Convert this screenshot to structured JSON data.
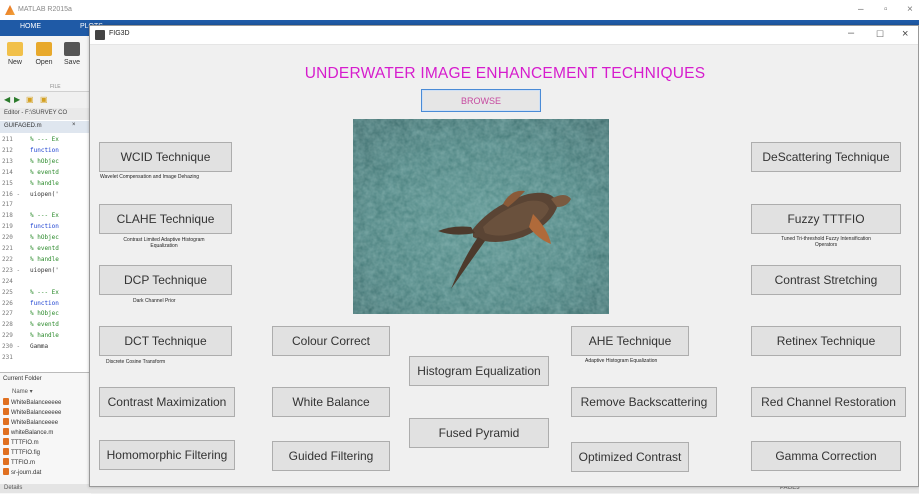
{
  "matlab": {
    "title": "MATLAB R2015a",
    "tabs": {
      "home": "HOME",
      "plots": "PLOTS"
    },
    "ribbon": {
      "new": "New",
      "open": "Open",
      "save": "Save",
      "file_group": "FILE"
    },
    "editor_title": "Editor - F:\\SURVEY CO",
    "editor_tab": "GUIFAGED.m",
    "code_lines": [
      {
        "n": "211",
        "t": "% --- Ex",
        "k": "comment"
      },
      {
        "n": "212",
        "t": "function",
        "k": "kw"
      },
      {
        "n": "213",
        "t": "% hObjec",
        "k": "comment"
      },
      {
        "n": "214",
        "t": "% eventd",
        "k": "comment"
      },
      {
        "n": "215",
        "t": "% handle",
        "k": "comment"
      },
      {
        "n": "216 -",
        "t": "uiopen('",
        "k": "fn"
      },
      {
        "n": "217",
        "t": "",
        "k": "fn"
      },
      {
        "n": "218",
        "t": "% --- Ex",
        "k": "comment"
      },
      {
        "n": "219",
        "t": "function",
        "k": "kw"
      },
      {
        "n": "220",
        "t": "% hObjec",
        "k": "comment"
      },
      {
        "n": "221",
        "t": "% eventd",
        "k": "comment"
      },
      {
        "n": "222",
        "t": "% handle",
        "k": "comment"
      },
      {
        "n": "223 -",
        "t": "uiopen('",
        "k": "fn"
      },
      {
        "n": "224",
        "t": "",
        "k": "fn"
      },
      {
        "n": "225",
        "t": "% --- Ex",
        "k": "comment"
      },
      {
        "n": "226",
        "t": "function",
        "k": "kw"
      },
      {
        "n": "227",
        "t": "% hObjec",
        "k": "comment"
      },
      {
        "n": "228",
        "t": "% eventd",
        "k": "comment"
      },
      {
        "n": "229",
        "t": "% handle",
        "k": "comment"
      },
      {
        "n": "230 -",
        "t": "Gamma",
        "k": "fn"
      },
      {
        "n": "231",
        "t": "",
        "k": "fn"
      }
    ],
    "current_folder": {
      "header": "Current Folder",
      "name_col": "Name ▾",
      "files": [
        "WhiteBalanceeeee",
        "WhiteBalanceeeee",
        "WhiteBalanceeee",
        "whiteBalance.m",
        "TTTFIO.m",
        "TTTFIO.fig",
        "TTFIO.m",
        "sr-journ.dat"
      ]
    },
    "status_left": "Details",
    "status_right": "PAGE3"
  },
  "figure": {
    "window_title": "FIG3D",
    "heading": "UNDERWATER IMAGE ENHANCEMENT TECHNIQUES",
    "browse": "BROWSE",
    "buttons": {
      "wcid": "WCID Technique",
      "clahe": "CLAHE Technique",
      "dcp": "DCP Technique",
      "dct": "DCT Technique",
      "contrast_max": "Contrast Maximization",
      "homomorphic": "Homomorphic Filtering",
      "colour_correct": "Colour Correct",
      "white_balance": "White Balance",
      "guided_filtering": "Guided Filtering",
      "histogram_eq": "Histogram Equalization",
      "fused_pyramid": "Fused Pyramid",
      "ahe": "AHE Technique",
      "remove_backscatter": "Remove Backscattering",
      "optimized_contrast": "Optimized Contrast",
      "descattering": "DeScattering Technique",
      "fuzzy_tttfio": "Fuzzy TTTFIO",
      "contrast_stretching": "Contrast Stretching",
      "retinex": "Retinex Technique",
      "red_channel": "Red Channel Restoration",
      "gamma": "Gamma Correction"
    },
    "captions": {
      "wcid": "Wavelet Compensation and Image Dehazing",
      "clahe_1": "Contrast Limited Adaptive Histogram",
      "clahe_2": "Equalization",
      "dcp": "Dark Channel Prior",
      "dct": "Discrete Cosine Transform",
      "ahe": "Adaptive Histogram Equalization",
      "fuzzy_1": "Tuned Tri-threshold Fuzzy Intensification",
      "fuzzy_2": "Operators"
    }
  },
  "colors": {
    "heading": "#d61ccd",
    "matlab_tab": "#1f5aa6",
    "button_bg": "#e1e1e1"
  },
  "icons": [
    "matlab-logo-icon",
    "figure-app-icon",
    "new-file-icon",
    "open-folder-icon",
    "save-icon",
    "back-arrow-icon",
    "forward-arrow-icon",
    "file-icon"
  ]
}
